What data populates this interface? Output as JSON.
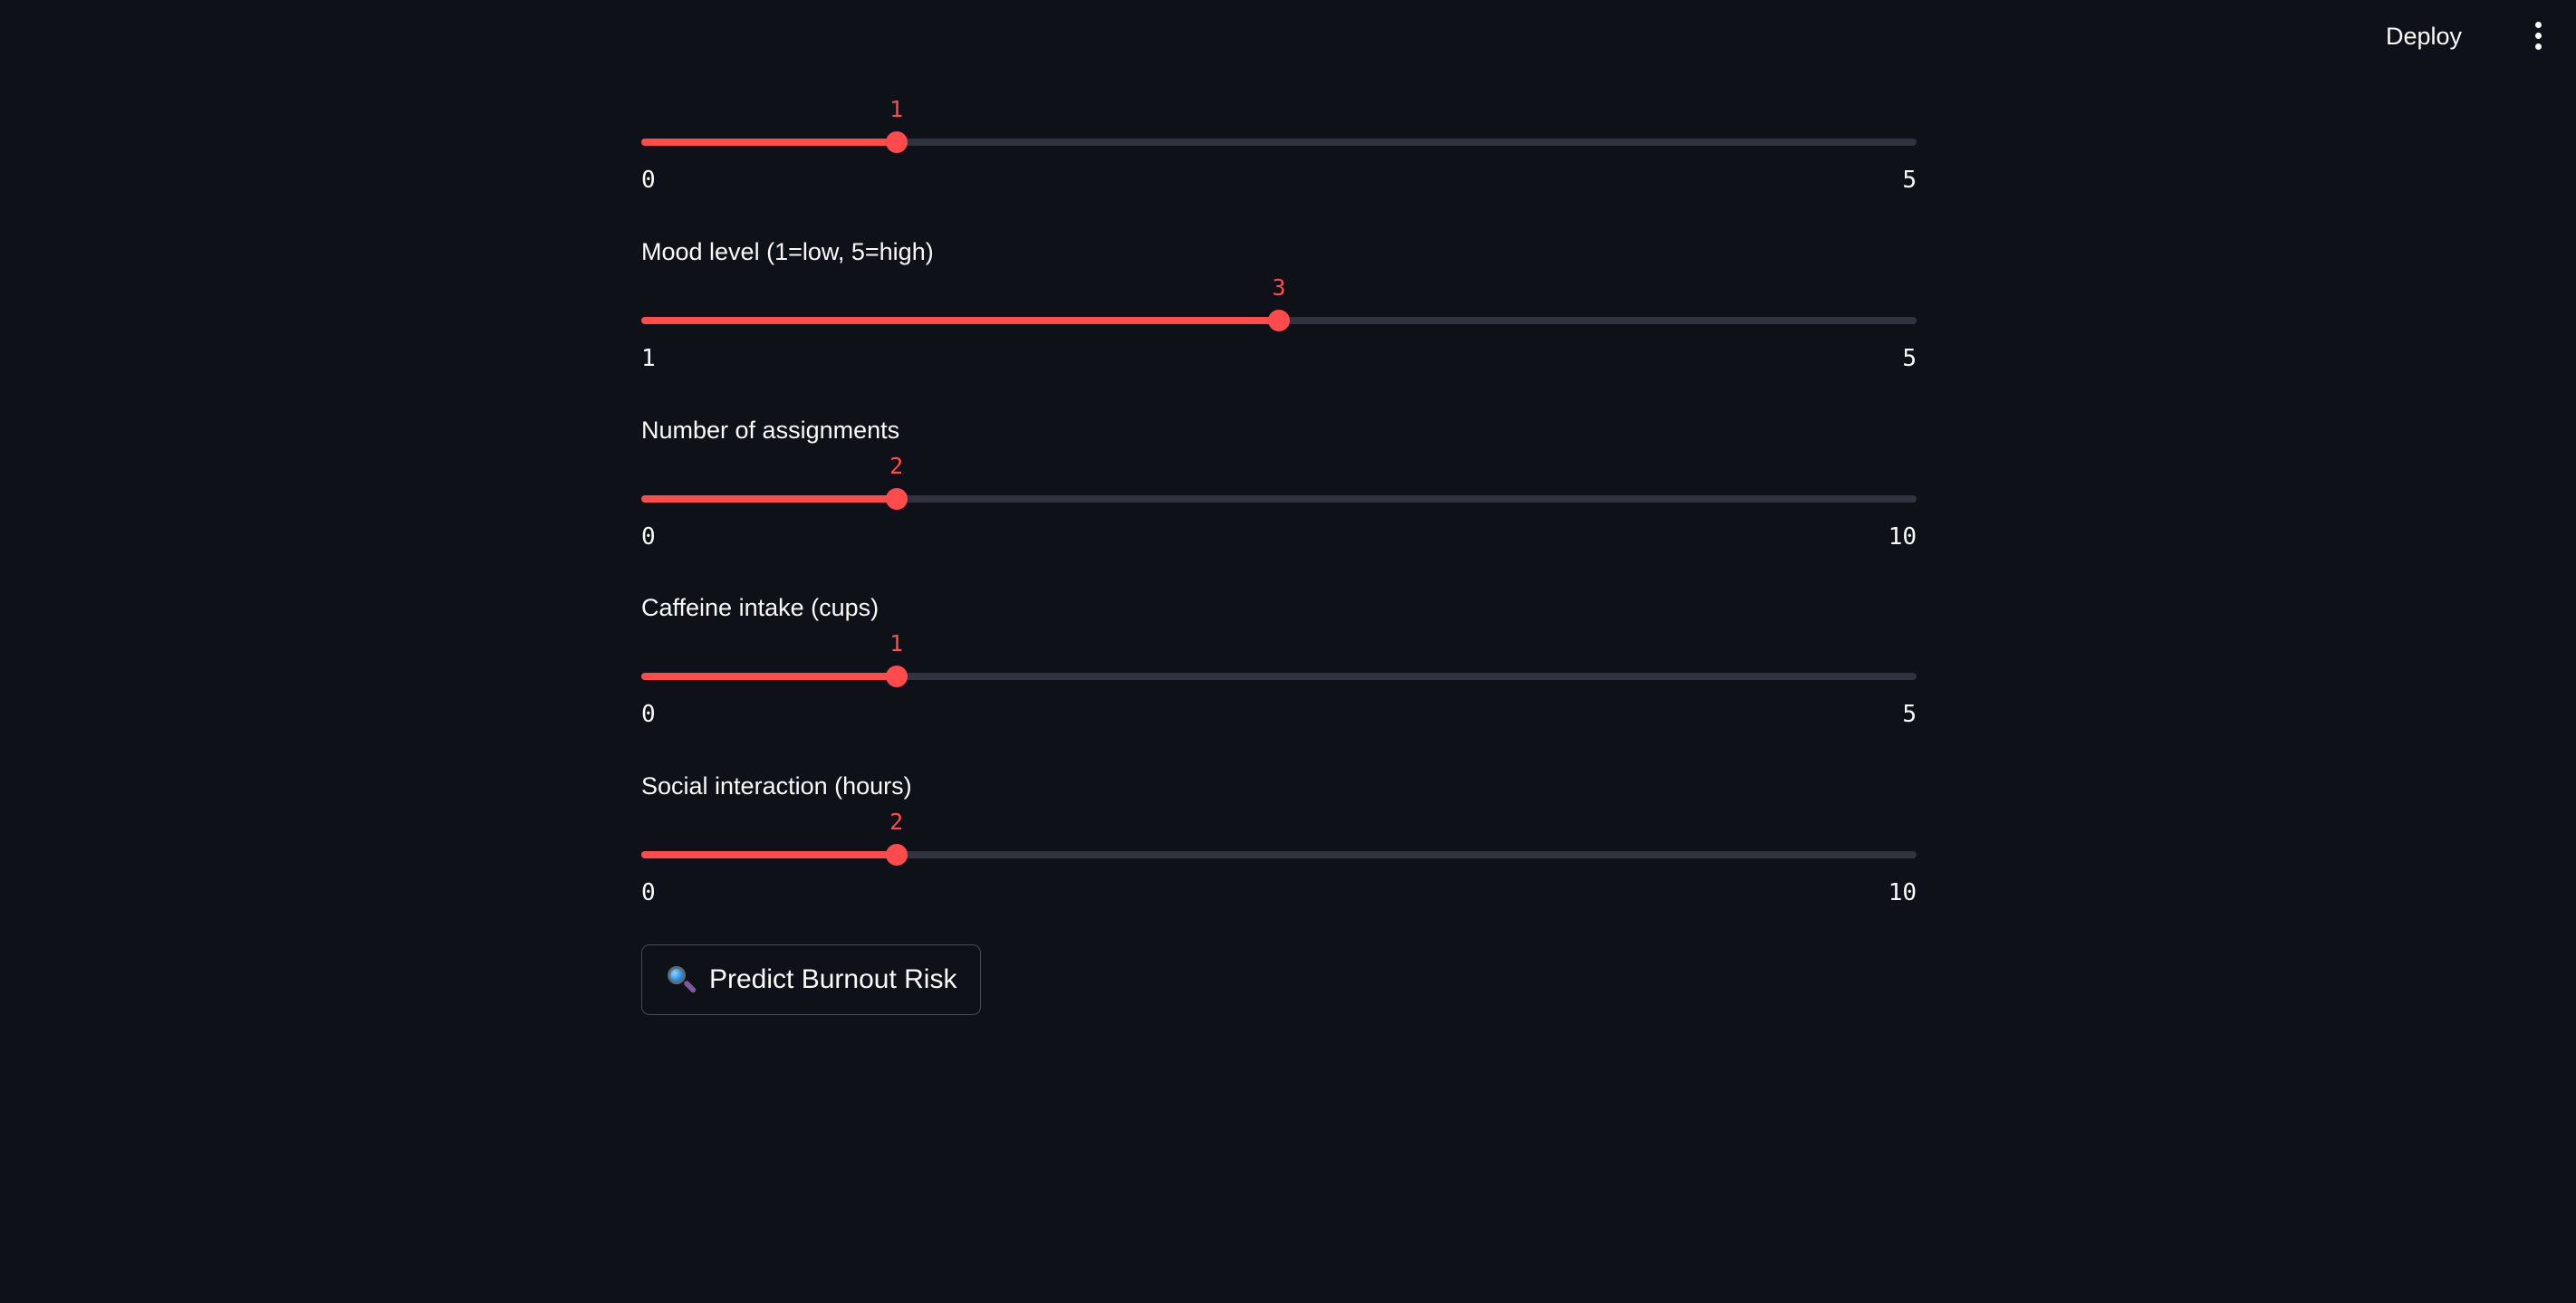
{
  "header": {
    "deploy_label": "Deploy",
    "menu_icon": "vertical-ellipsis-icon"
  },
  "colors": {
    "background": "#0e1117",
    "accent": "#ff4b4b",
    "track": "#31333f",
    "text": "#fafafa"
  },
  "sliders": [
    {
      "label": "",
      "value": "1",
      "min": "0",
      "max": "5",
      "fraction": 0.2
    },
    {
      "label": "Mood level (1=low, 5=high)",
      "value": "3",
      "min": "1",
      "max": "5",
      "fraction": 0.5
    },
    {
      "label": "Number of assignments",
      "value": "2",
      "min": "0",
      "max": "10",
      "fraction": 0.2
    },
    {
      "label": "Caffeine intake (cups)",
      "value": "1",
      "min": "0",
      "max": "5",
      "fraction": 0.2
    },
    {
      "label": "Social interaction (hours)",
      "value": "2",
      "min": "0",
      "max": "10",
      "fraction": 0.2
    }
  ],
  "predict_button": {
    "label": "Predict Burnout Risk",
    "icon": "magnifying-glass-icon"
  }
}
